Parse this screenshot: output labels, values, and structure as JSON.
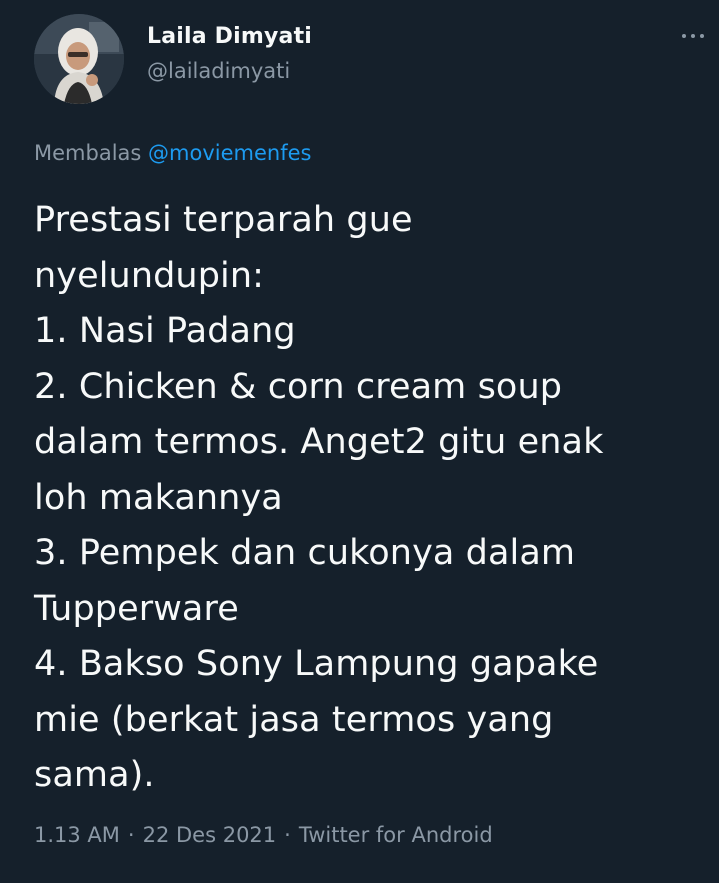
{
  "tweet": {
    "author": {
      "display_name": "Laila Dimyati",
      "handle": "@lailadimyati",
      "avatar": "user-avatar-photo"
    },
    "reply_to": {
      "label": "Membalas",
      "mention": "@moviemenfes"
    },
    "text": "Prestasi terparah gue\nnyelundupin:\n1. Nasi Padang\n2. Chicken & corn cream soup\ndalam termos. Anget2 gitu enak\nloh makannya\n3. Pempek dan cukonya dalam\nTupperware\n4. Bakso Sony Lampung gapake\nmie (berkat jasa termos yang\nsama).",
    "time": "1.13 AM",
    "date": "22 Des 2021",
    "source": "Twitter for Android",
    "separator": "·",
    "more_icon": "more-options-icon"
  },
  "colors": {
    "background": "#15202b",
    "primary_text": "#f7f9f9",
    "secondary_text": "#8b98a5",
    "accent": "#1d9bf0"
  }
}
